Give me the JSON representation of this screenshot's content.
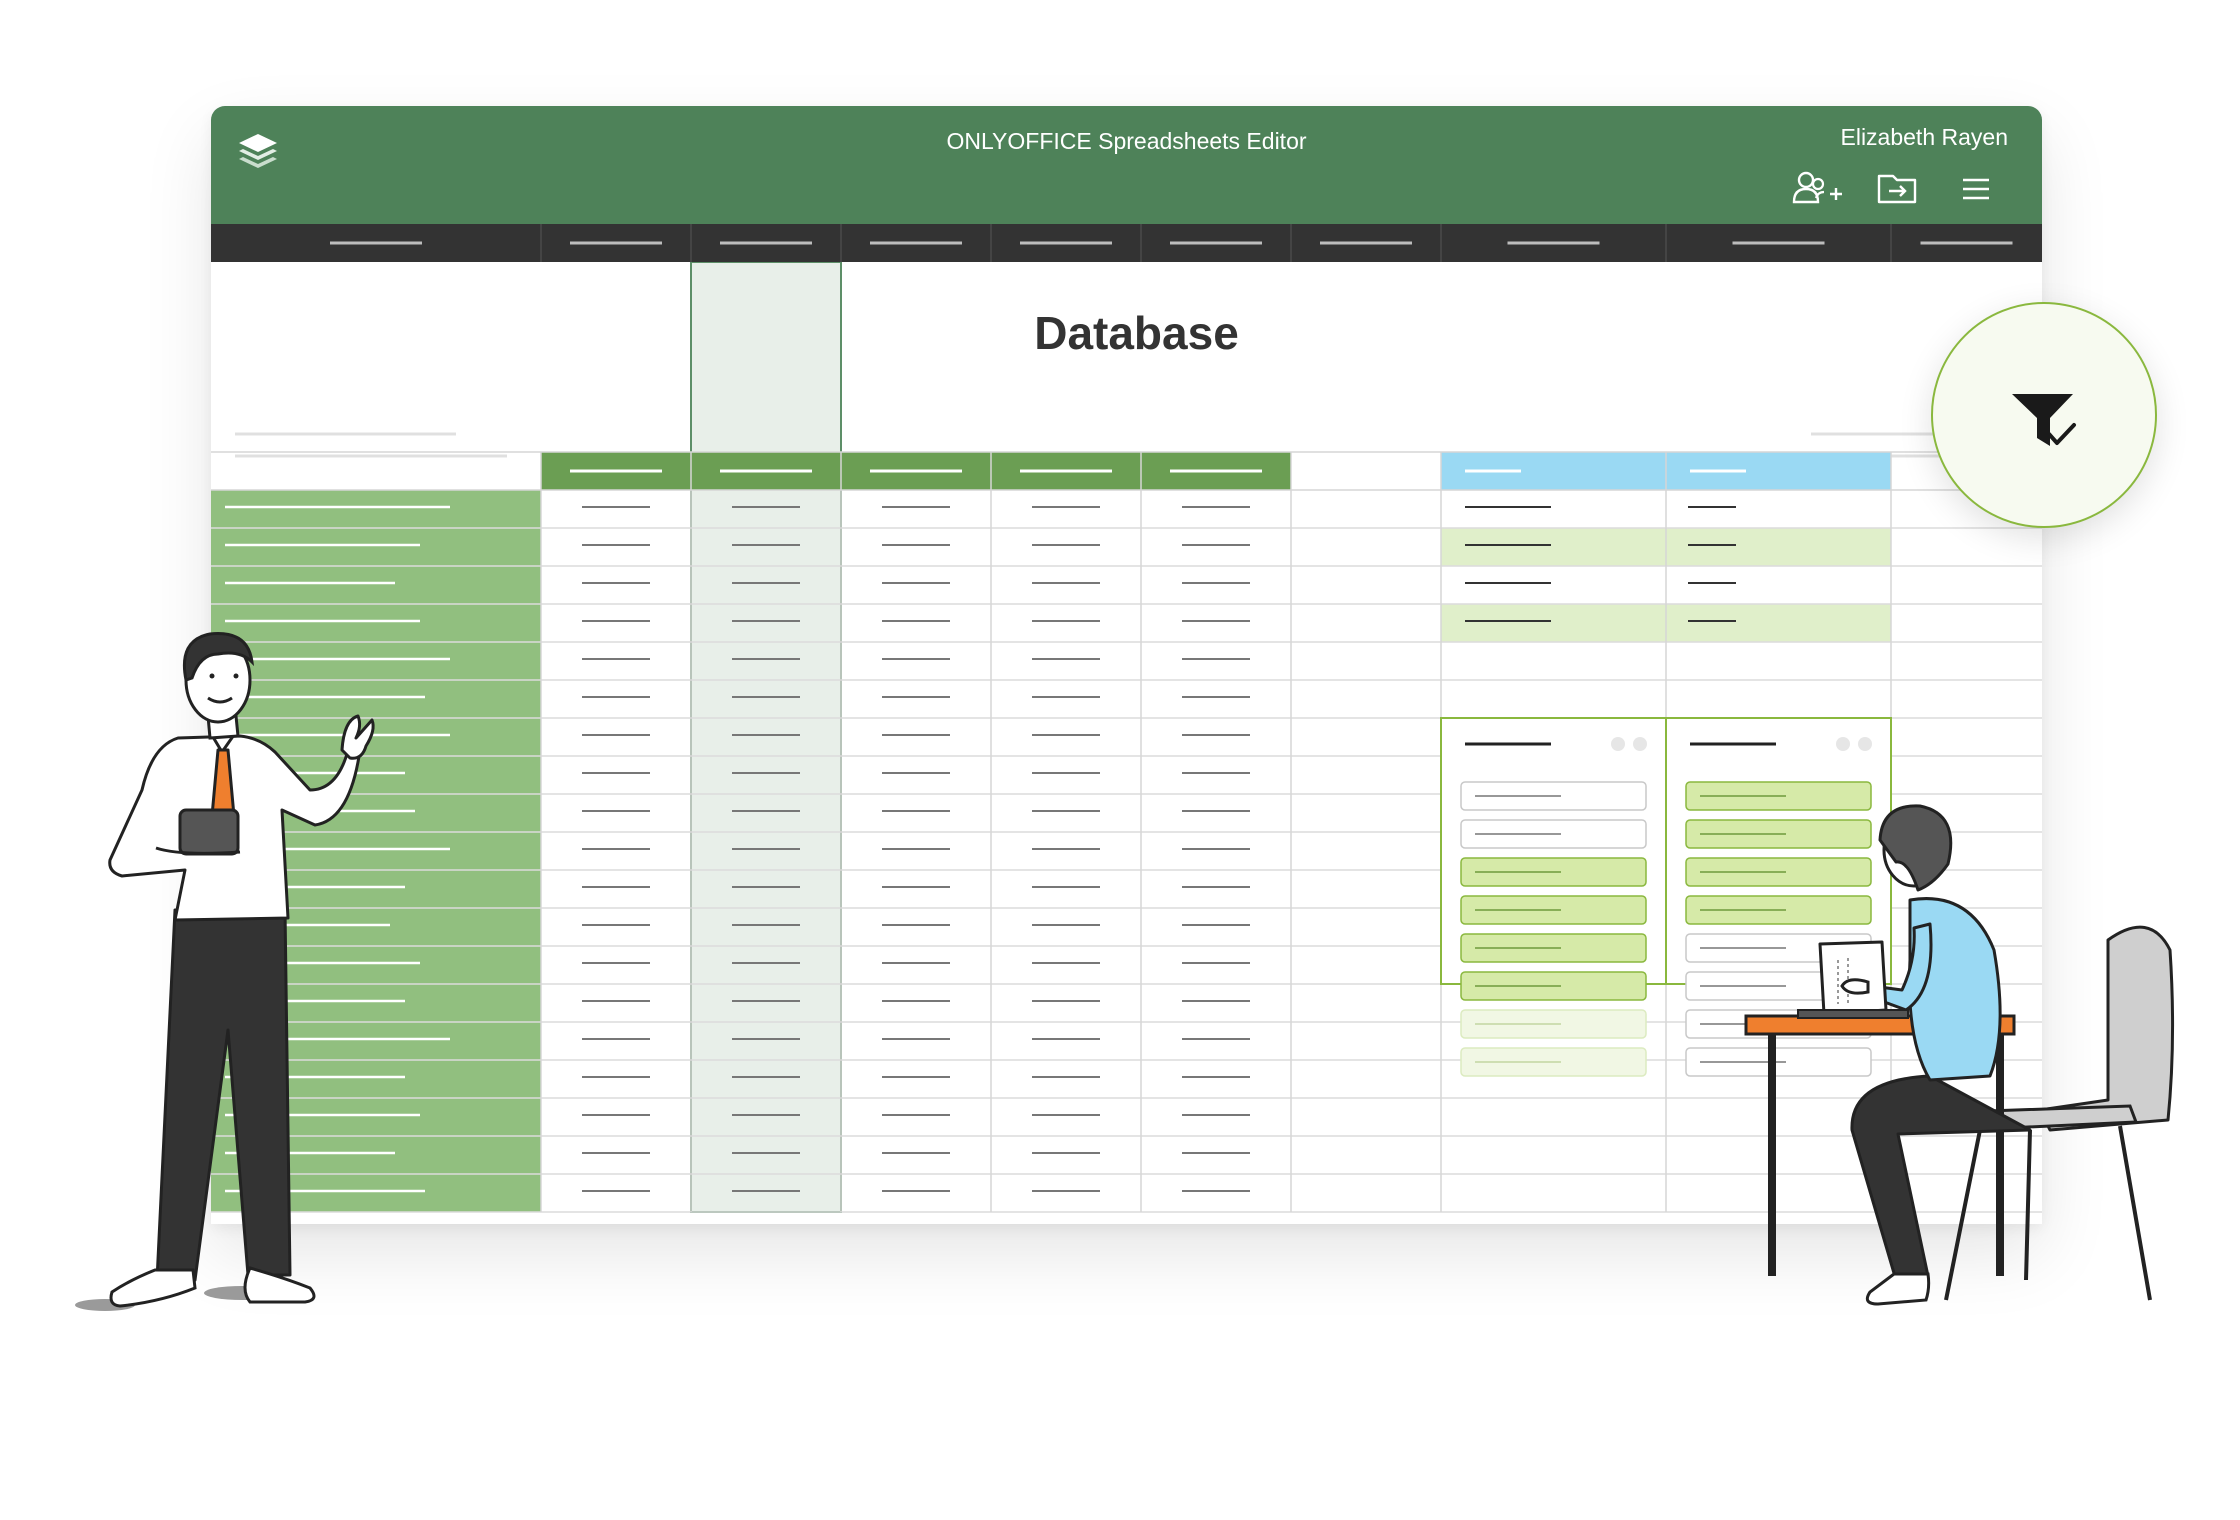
{
  "app": {
    "title": "ONLYOFFICE Spreadsheets Editor",
    "user": "Elizabeth Rayen"
  },
  "toolbar": {
    "icons": [
      "add-user-icon",
      "move-to-folder-icon",
      "menu-icon"
    ]
  },
  "sheet": {
    "title": "Database"
  },
  "filter": {
    "icon": "filter-applied-icon"
  },
  "colors": {
    "header": "#4e8259",
    "column_bar": "#333333",
    "row_header_fill": "#91bf7f",
    "table_header": "#6b9e53",
    "selected_column": "#e8efe9",
    "blue_header": "#9ad9f3",
    "highlight_row": "#e0efca",
    "filter_border": "#8ab83e"
  }
}
